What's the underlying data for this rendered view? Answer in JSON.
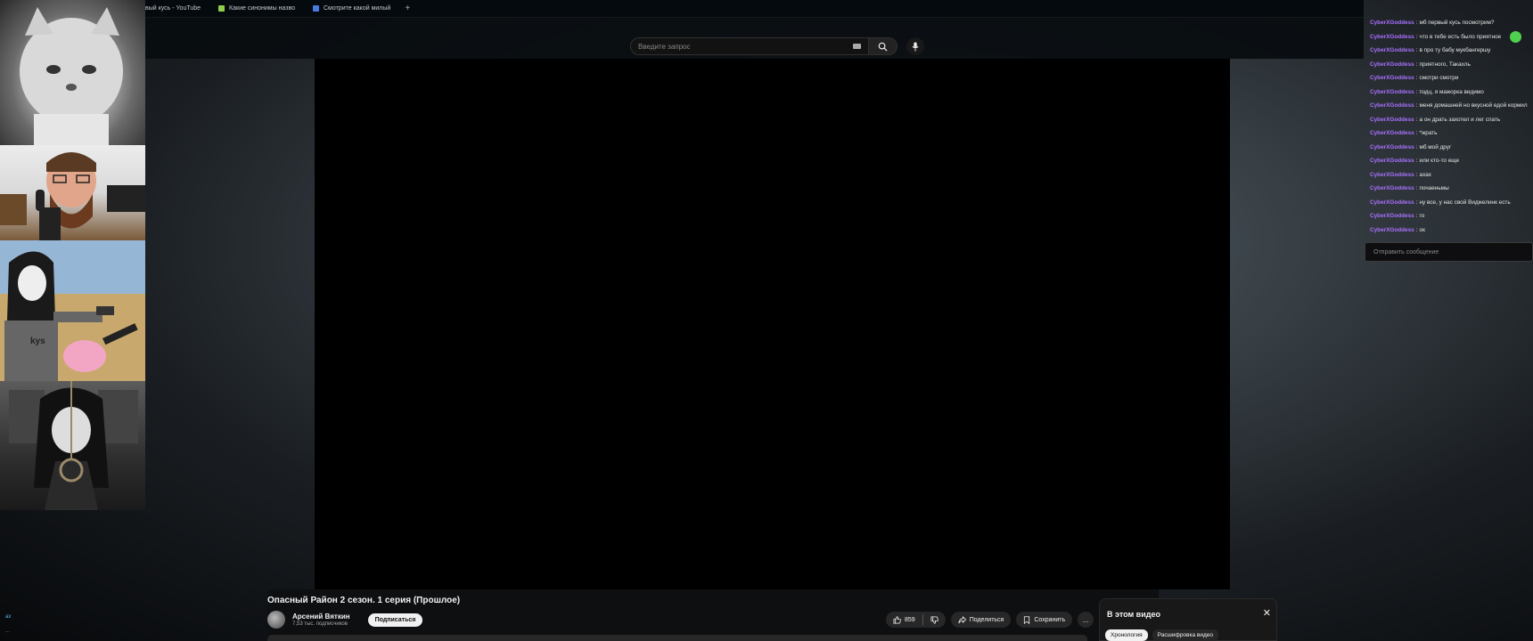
{
  "browser": {
    "tabs": [
      {
        "label": "вый кусь - YouTube",
        "favicon": "youtube-icon"
      },
      {
        "label": "Какие синонимы назво",
        "favicon": "green-doc-icon"
      },
      {
        "label": "Смотрите какой милый",
        "favicon": "blue-chat-icon"
      }
    ],
    "new_tab": "+"
  },
  "search": {
    "placeholder": "Введите запрос"
  },
  "overlay_images": [
    {
      "name": "manul-cat-image"
    },
    {
      "name": "bearded-man-phone-image"
    },
    {
      "name": "anime-girl-gun-image",
      "text": "kys"
    },
    {
      "name": "anime-girl-rope-image"
    }
  ],
  "corner_text": {
    "a": "ax",
    "b": "..."
  },
  "chat": {
    "messages": [
      {
        "user": "CyberXGoddess",
        "text": "мб первый кусь посмотрим?"
      },
      {
        "user": "CyberXGoddess",
        "text": "что в тебе есть было приятное",
        "emote": true
      },
      {
        "user": "CyberXGoddess",
        "text": "в про ту бабу мукбангершу"
      },
      {
        "user": "CyberXGoddess",
        "text": "приятного, Такахль"
      },
      {
        "user": "CyberXGoddess",
        "text": "смотри смотри"
      },
      {
        "user": "CyberXGoddess",
        "text": "пздц, я мажорка видимо"
      },
      {
        "user": "CyberXGoddess",
        "text": "меня домашней но вкусной едой кормил"
      },
      {
        "user": "CyberXGoddess",
        "text": "а он драть захотел и лег спать"
      },
      {
        "user": "CyberXGoddess",
        "text": "*жрать"
      },
      {
        "user": "CyberXGoddess",
        "text": "мб мой друг"
      },
      {
        "user": "CyberXGoddess",
        "text": "или кто-то еще"
      },
      {
        "user": "CyberXGoddess",
        "text": "ахах"
      },
      {
        "user": "CyberXGoddess",
        "text": "почаеньмы"
      },
      {
        "user": "CyberXGoddess",
        "text": "ну все, у нас свой Виджелинк есть"
      },
      {
        "user": "CyberXGoddess",
        "text": "го"
      },
      {
        "user": "CyberXGoddess",
        "text": "ок"
      }
    ],
    "input_placeholder": "Отправить сообщение"
  },
  "video": {
    "title": "Опасный Район 2 сезон. 1 серия (Прошлое)",
    "channel": "Арсений Вяткин",
    "subscribers": "7,53 тыс. подписчиков",
    "subscribe_label": "Подписаться",
    "likes": "859",
    "share_label": "Поделиться",
    "save_label": "Сохранить",
    "more_label": "..."
  },
  "in_this_video": {
    "title": "В этом видео",
    "tabs": [
      "Хронология",
      "Расшифровка видео"
    ]
  },
  "colors": {
    "chat_user": "#a970ff",
    "accent": "#f1f1f1"
  }
}
